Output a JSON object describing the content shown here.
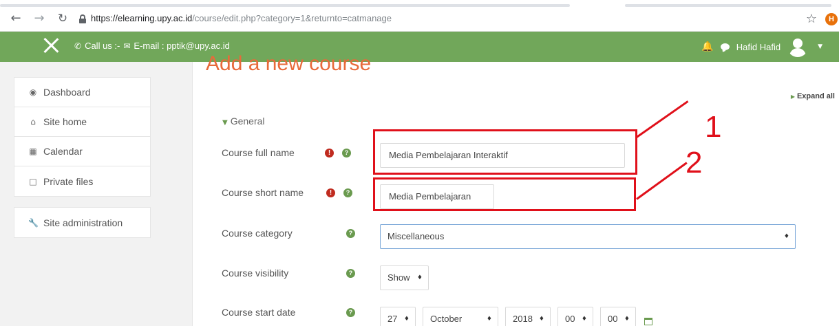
{
  "browser": {
    "url_host": "https://elearning.upy.ac.id",
    "url_path": "/course/edit.php?category=1&returnto=catmanage",
    "back_icon": "arrow-left-icon",
    "forward_icon": "arrow-right-icon",
    "reload_icon": "reload-icon",
    "profile_initial": "H"
  },
  "navbar": {
    "call_label": "Call us :-",
    "email_label": "E-mail : pptik@upy.ac.id",
    "user_name": "Hafid Hafid"
  },
  "sidebar": {
    "items": [
      {
        "label": "Dashboard",
        "icon": "dashboard-icon"
      },
      {
        "label": "Site home",
        "icon": "home-icon"
      },
      {
        "label": "Calendar",
        "icon": "calendar-icon"
      },
      {
        "label": "Private files",
        "icon": "file-icon"
      }
    ],
    "admin_label": "Site administration"
  },
  "main": {
    "heading": "Add a new course",
    "expand_all": "Expand all",
    "section": "General",
    "fields": {
      "full_name_label": "Course full name",
      "full_name_value": "Media Pembelajaran Interaktif",
      "short_name_label": "Course short name",
      "short_name_value": "Media Pembelajaran",
      "category_label": "Course category",
      "category_value": "Miscellaneous",
      "visibility_label": "Course visibility",
      "visibility_value": "Show",
      "start_date_label": "Course start date",
      "start_day": "27",
      "start_month": "October",
      "start_year": "2018",
      "start_hour": "00",
      "start_minute": "00"
    }
  },
  "annotations": {
    "one": "1",
    "two": "2"
  },
  "colors": {
    "navbar": "#71a75a",
    "heading": "#e86a3a",
    "annotation": "#e0101a",
    "required": "#c02b1f"
  }
}
